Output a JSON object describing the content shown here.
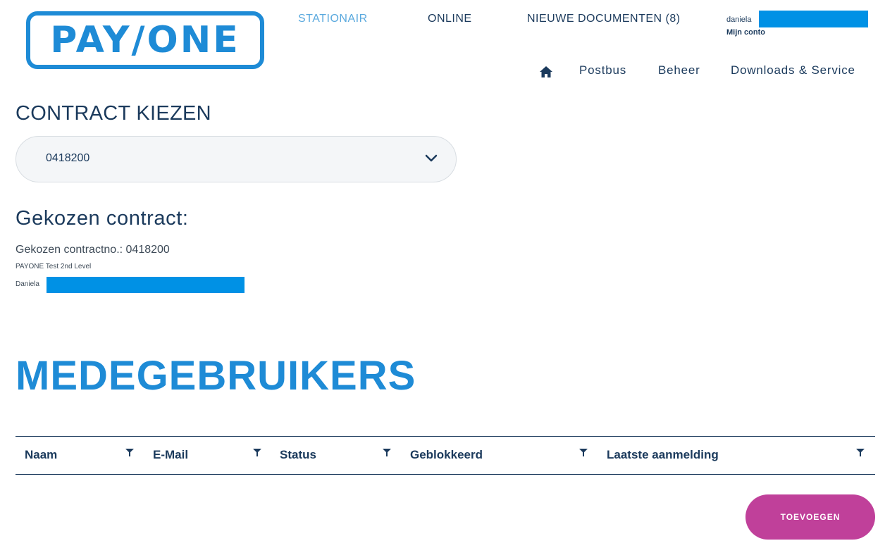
{
  "brand": {
    "logo_text": "PAY/ONE",
    "accent": "#1e8bd6",
    "primary_text": "#1b3a5c",
    "button_color": "#c0409a",
    "redaction_color": "#0091e5"
  },
  "top_nav": {
    "stationair": "STATIONAIR",
    "online": "ONLINE",
    "nieuwe_documenten": "NIEUWE DOCUMENTEN (8)"
  },
  "user": {
    "name": "daniela",
    "account_link": "Mijn conto"
  },
  "sub_nav": {
    "home_icon": "home-icon",
    "postbus": "Postbus",
    "beheer": "Beheer",
    "downloads": "Downloads & Service"
  },
  "contract_select": {
    "heading": "CONTRACT KIEZEN",
    "selected_value": "0418200",
    "icon": "chevron-down-icon"
  },
  "chosen_contract": {
    "heading": "Gekozen contract:",
    "contract_no_line": "Gekozen contractno.: 0418200",
    "company": "PAYONE Test 2nd Level",
    "user_prefix": "Daniela"
  },
  "section": {
    "title": "MEDEGEBRUIKERS"
  },
  "table": {
    "columns": [
      "Naam",
      "E-Mail",
      "Status",
      "Geblokkeerd",
      "Laatste aanmelding"
    ],
    "filter_icon": "filter-icon",
    "rows": []
  },
  "actions": {
    "add_label": "TOEVOEGEN"
  }
}
